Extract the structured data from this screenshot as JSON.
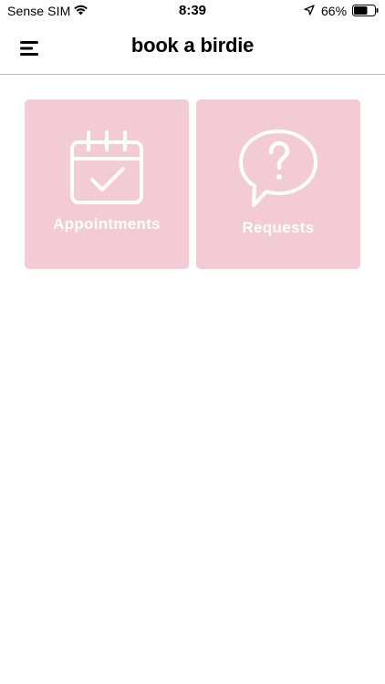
{
  "status_bar": {
    "carrier": "Sense SIM",
    "time": "8:39",
    "battery_percent": "66%",
    "battery_level": 0.66,
    "icons": [
      "wifi-icon",
      "location-arrow-icon",
      "battery-icon"
    ]
  },
  "nav": {
    "title": "book a birdie",
    "menu_icon": "hamburger-menu-icon"
  },
  "tiles": [
    {
      "label": "Appointments",
      "icon": "calendar-check-icon"
    },
    {
      "label": "Requests",
      "icon": "question-bubble-icon"
    }
  ],
  "colors": {
    "tile_background": "#f3cbd4",
    "tile_foreground": "#ffffff",
    "divider": "#bdbdbd"
  }
}
